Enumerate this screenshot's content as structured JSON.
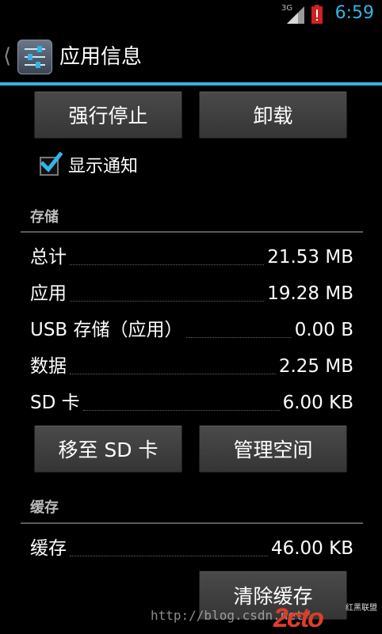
{
  "status_bar": {
    "network": "3G",
    "time": "6:59"
  },
  "action_bar": {
    "title": "应用信息",
    "icon": "settings-sliders-icon"
  },
  "buttons": {
    "force_stop": "强行停止",
    "uninstall": "卸载",
    "move_to_sd": "移至 SD 卡",
    "manage_space": "管理空间",
    "clear_cache": "清除缓存"
  },
  "notifications": {
    "label": "显示通知",
    "checked": true
  },
  "storage": {
    "header": "存储",
    "rows": [
      {
        "label": "总计",
        "value": "21.53 MB"
      },
      {
        "label": "应用",
        "value": "19.28 MB"
      },
      {
        "label": "USB 存储（应用）",
        "value": "0.00 B"
      },
      {
        "label": "数据",
        "value": "2.25 MB"
      },
      {
        "label": "SD 卡",
        "value": "6.00 KB"
      }
    ]
  },
  "cache": {
    "header": "缓存",
    "rows": [
      {
        "label": "缓存",
        "value": "46.00 KB"
      }
    ]
  },
  "watermark": {
    "url": "http://blog.csdn.net/",
    "logo": "2cto",
    "site": "红黑联盟"
  },
  "colors": {
    "accent": "#33b5e5",
    "background": "#000000",
    "button": "#3f3f3f"
  }
}
